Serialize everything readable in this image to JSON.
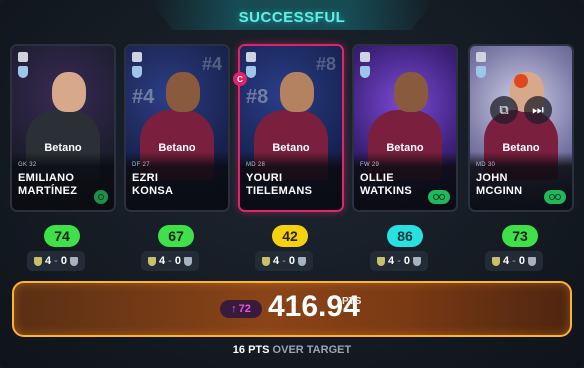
{
  "header": {
    "title": "SUCCESSFUL"
  },
  "cards": [
    {
      "first_name": "EMILIANO",
      "last_name": "MARTÍNEZ",
      "meta": "GK 32",
      "shirt_number": "",
      "sponsor": "Betano",
      "score": "74",
      "score_color": "green",
      "fixture": {
        "home": "4",
        "sep": "-",
        "away": "0"
      }
    },
    {
      "first_name": "EZRI",
      "last_name": "KONSA",
      "meta": "DF 27",
      "shirt_number": "#4",
      "sponsor": "Betano",
      "score": "67",
      "score_color": "green",
      "fixture": {
        "home": "4",
        "sep": "-",
        "away": "0"
      }
    },
    {
      "first_name": "YOURI",
      "last_name": "TIELEMANS",
      "meta": "MD 28",
      "shirt_number": "#8",
      "sponsor": "Betano",
      "score": "42",
      "score_color": "yellow",
      "fixture": {
        "home": "4",
        "sep": "-",
        "away": "0"
      }
    },
    {
      "first_name": "OLLIE",
      "last_name": "WATKINS",
      "meta": "FW 29",
      "shirt_number": "",
      "sponsor": "Betano",
      "score": "86",
      "score_color": "cyan",
      "fixture": {
        "home": "4",
        "sep": "-",
        "away": "0"
      }
    },
    {
      "first_name": "JOHN",
      "last_name": "MCGINN",
      "meta": "MD 30",
      "shirt_number": "",
      "sponsor": "Betano",
      "score": "73",
      "score_color": "green",
      "fixture": {
        "home": "4",
        "sep": "-",
        "away": "0"
      }
    }
  ],
  "badges": {
    "captain": "C"
  },
  "overlay": {
    "copy_icon": "copy-icon",
    "skip_icon": "fast-forward-icon"
  },
  "total": {
    "delta": "72",
    "value": "416.94",
    "unit": "PTS"
  },
  "footer": {
    "margin": "16 PTS",
    "suffix": "OVER TARGET"
  },
  "colors": {
    "accent": "#5ff0e6",
    "captain": "#e0246a",
    "total_border": "#ffb23a"
  }
}
